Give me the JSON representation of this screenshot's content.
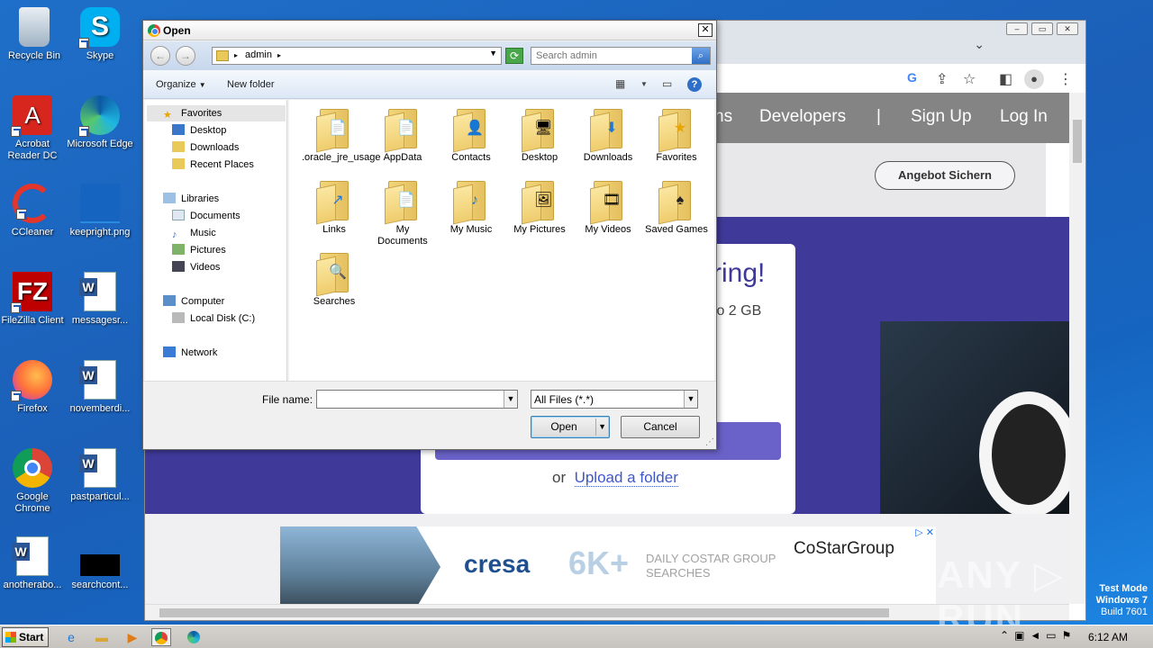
{
  "desktop": {
    "icons": [
      {
        "label": "Recycle Bin",
        "icon": "recycle-bin-icon"
      },
      {
        "label": "Skype",
        "icon": "skype-icon"
      },
      {
        "label": "Acrobat Reader DC",
        "icon": "acrobat-icon"
      },
      {
        "label": "Microsoft Edge",
        "icon": "edge-icon"
      },
      {
        "label": "CCleaner",
        "icon": "ccleaner-icon"
      },
      {
        "label": "keepright.png",
        "icon": "image-file-icon"
      },
      {
        "label": "FileZilla Client",
        "icon": "filezilla-icon"
      },
      {
        "label": "messagesr...",
        "icon": "word-doc-icon"
      },
      {
        "label": "Firefox",
        "icon": "firefox-icon"
      },
      {
        "label": "novemberdi...",
        "icon": "word-doc-icon"
      },
      {
        "label": "Google Chrome",
        "icon": "chrome-icon"
      },
      {
        "label": "pastparticul...",
        "icon": "word-doc-icon"
      },
      {
        "label": "anotherabo...",
        "icon": "word-doc-icon"
      },
      {
        "label": "searchcont...",
        "icon": "black-file-icon"
      }
    ]
  },
  "browser": {
    "nav": [
      "ns",
      "Developers",
      "|",
      "Sign Up",
      "Log In"
    ],
    "cta": "Angebot Sichern",
    "headline": "ring!",
    "subline": "to 2 GB",
    "or_text": "or",
    "upload_folder": "Upload a folder",
    "ad": {
      "cresa": "cresa",
      "big": "6K+",
      "line1": "DAILY COSTAR GROUP",
      "line2": "SEARCHES",
      "costar": "CoStarGroup",
      "adchoices": "▷ ✕"
    }
  },
  "dialog": {
    "title": "Open",
    "close": "✕",
    "address": "admin",
    "search_placeholder": "Search admin",
    "organize": "Organize",
    "new_folder": "New folder",
    "help": "?",
    "nav": {
      "favorites": "Favorites",
      "desktop": "Desktop",
      "downloads": "Downloads",
      "recent": "Recent Places",
      "libraries": "Libraries",
      "documents": "Documents",
      "music": "Music",
      "pictures": "Pictures",
      "videos": "Videos",
      "computer": "Computer",
      "localdisk": "Local Disk (C:)",
      "network": "Network"
    },
    "files": [
      {
        "name": ".oracle_jre_usage",
        "emblem": "📄"
      },
      {
        "name": "AppData",
        "emblem": "📄"
      },
      {
        "name": "Contacts",
        "emblem": "👤"
      },
      {
        "name": "Desktop",
        "emblem": "🖥"
      },
      {
        "name": "Downloads",
        "emblem": "⬇"
      },
      {
        "name": "Favorites",
        "emblem": "★"
      },
      {
        "name": "Links",
        "emblem": "↗"
      },
      {
        "name": "My Documents",
        "emblem": "📄"
      },
      {
        "name": "My Music",
        "emblem": "♪"
      },
      {
        "name": "My Pictures",
        "emblem": "🖼"
      },
      {
        "name": "My Videos",
        "emblem": "🎞"
      },
      {
        "name": "Saved Games",
        "emblem": "♠"
      },
      {
        "name": "Searches",
        "emblem": "🔍"
      }
    ],
    "file_name_label": "File name:",
    "file_name_value": "",
    "filter": "All Files (*.*)",
    "open": "Open",
    "cancel": "Cancel"
  },
  "taskbar": {
    "start": "Start",
    "clock": "6:12 AM"
  },
  "watermark": {
    "line1": "Test Mode",
    "line2": "Windows 7",
    "line3": "Build 7601",
    "brand": "ANY ▷ RUN"
  }
}
